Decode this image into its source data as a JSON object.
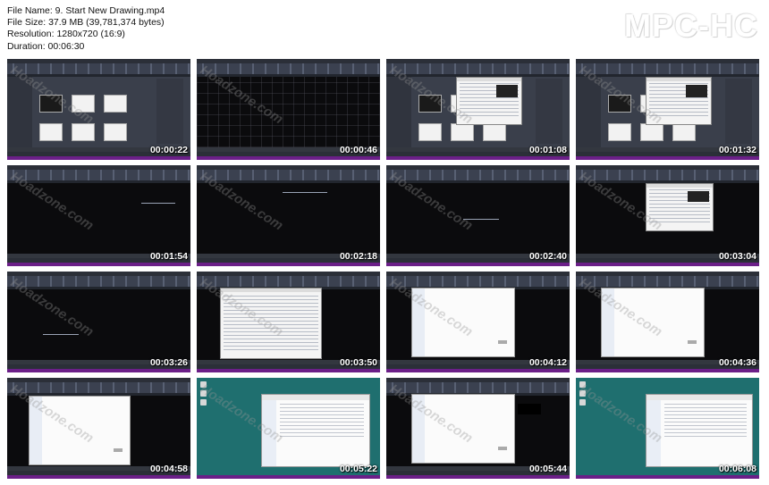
{
  "header": {
    "file_name": "File Name: 9. Start New Drawing.mp4",
    "file_size": "File Size: 37.9 MB (39,781,374 bytes)",
    "resolution": "Resolution: 1280x720 (16:9)",
    "duration": "Duration: 00:06:30",
    "logo": "MPC-HC"
  },
  "watermark": "Hoadzone.com",
  "colors": {
    "autocad_dark": "#0b0b0d",
    "ribbon": "#3b4150",
    "taskbar_purple": "#6b1f88",
    "desktop_teal": "#1f6f6f"
  },
  "thumbnails": [
    {
      "time": "00:00:22",
      "scene": "start-tab"
    },
    {
      "time": "00:00:46",
      "scene": "empty-grid"
    },
    {
      "time": "00:01:08",
      "scene": "start-tab-dialog"
    },
    {
      "time": "00:01:32",
      "scene": "start-tab-dialog"
    },
    {
      "time": "00:01:54",
      "scene": "drawing-line"
    },
    {
      "time": "00:02:18",
      "scene": "drawing-line"
    },
    {
      "time": "00:02:40",
      "scene": "drawing-line"
    },
    {
      "time": "00:03:04",
      "scene": "drawing-dialog"
    },
    {
      "time": "00:03:26",
      "scene": "drawing-line"
    },
    {
      "time": "00:03:50",
      "scene": "options-dialog"
    },
    {
      "time": "00:04:12",
      "scene": "white-dialog"
    },
    {
      "time": "00:04:36",
      "scene": "white-dialog"
    },
    {
      "time": "00:04:58",
      "scene": "white-dialog"
    },
    {
      "time": "00:05:22",
      "scene": "desktop-explorer"
    },
    {
      "time": "00:05:44",
      "scene": "white-dialog-black"
    },
    {
      "time": "00:06:08",
      "scene": "desktop-explorer"
    }
  ]
}
